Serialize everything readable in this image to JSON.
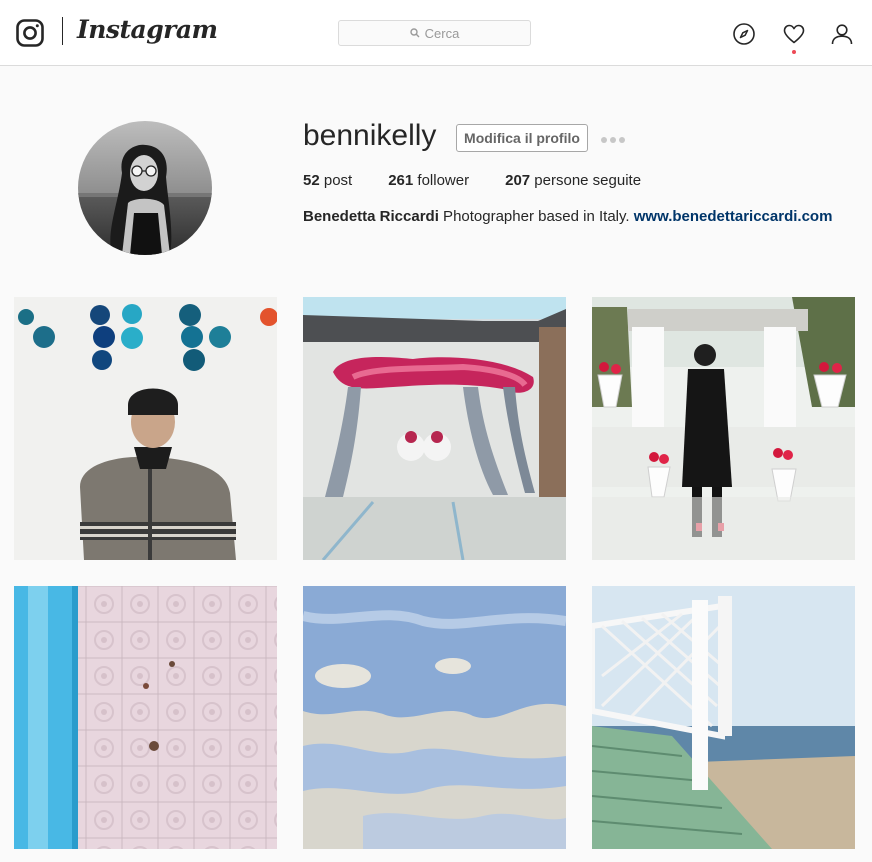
{
  "nav": {
    "brand": "Instagram",
    "search_placeholder": "Cerca",
    "icons": [
      "instagram-camera-icon",
      "compass-icon",
      "heart-icon",
      "user-icon"
    ]
  },
  "profile": {
    "username": "bennikelly",
    "edit_label": "Modifica il profilo",
    "stats": {
      "posts_count": "52",
      "posts_label": " post",
      "followers_count": "261",
      "followers_label": " follower",
      "following_count": "207",
      "following_label": " persone seguite"
    },
    "full_name": "Benedetta Riccardi",
    "bio_text": " Photographer based in Italy. ",
    "website": "www.benedettariccardi.com"
  },
  "colors": {
    "link": "#003569",
    "notification_dot": "#ed4956",
    "border": "#dbdbdb"
  }
}
